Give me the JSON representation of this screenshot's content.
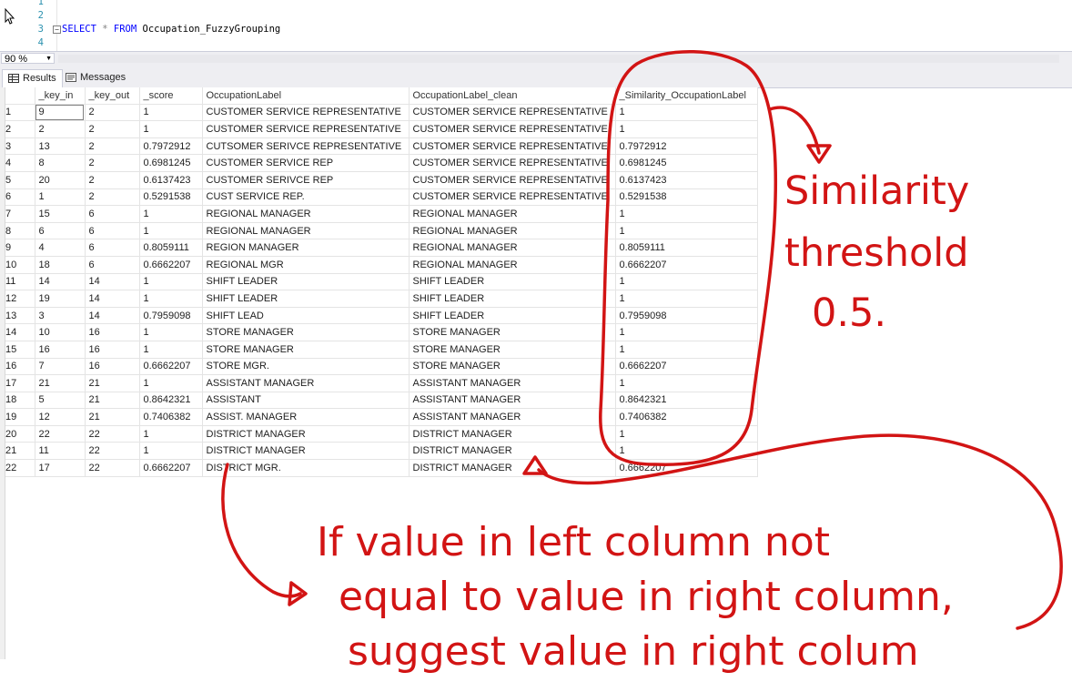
{
  "editor": {
    "lines": [
      {
        "num": "1",
        "code": ""
      },
      {
        "num": "2",
        "code": ""
      },
      {
        "num": "3",
        "kw1": "SELECT",
        "op": " * ",
        "kw2": "FROM",
        "rest": " Occupation_FuzzyGrouping"
      },
      {
        "num": "4",
        "code": ""
      }
    ],
    "collapse_glyph": "−"
  },
  "zoom": {
    "value": "90 %"
  },
  "tabs": {
    "results": "Results",
    "messages": "Messages"
  },
  "grid": {
    "columns": [
      "_key_in",
      "_key_out",
      "_score",
      "OccupationLabel",
      "OccupationLabel_clean",
      "_Similarity_OccupationLabel"
    ],
    "rows": [
      {
        "n": "1",
        "key_in": "9",
        "key_out": "2",
        "score": "1",
        "label": "CUSTOMER SERVICE REPRESENTATIVE",
        "clean": "CUSTOMER SERVICE REPRESENTATIVE",
        "sim": "1"
      },
      {
        "n": "2",
        "key_in": "2",
        "key_out": "2",
        "score": "1",
        "label": "CUSTOMER SERVICE REPRESENTATIVE",
        "clean": "CUSTOMER SERVICE REPRESENTATIVE",
        "sim": "1"
      },
      {
        "n": "3",
        "key_in": "13",
        "key_out": "2",
        "score": "0.7972912",
        "label": "CUTSOMER SERIVCE REPRESENTATIVE",
        "clean": "CUSTOMER SERVICE REPRESENTATIVE",
        "sim": "0.7972912"
      },
      {
        "n": "4",
        "key_in": "8",
        "key_out": "2",
        "score": "0.6981245",
        "label": "CUSTOMER SERVICE REP",
        "clean": "CUSTOMER SERVICE REPRESENTATIVE",
        "sim": "0.6981245"
      },
      {
        "n": "5",
        "key_in": "20",
        "key_out": "2",
        "score": "0.6137423",
        "label": "CUSTOMER SERIVCE REP",
        "clean": "CUSTOMER SERVICE REPRESENTATIVE",
        "sim": "0.6137423"
      },
      {
        "n": "6",
        "key_in": "1",
        "key_out": "2",
        "score": "0.5291538",
        "label": "CUST SERVICE REP.",
        "clean": "CUSTOMER SERVICE REPRESENTATIVE",
        "sim": "0.5291538"
      },
      {
        "n": "7",
        "key_in": "15",
        "key_out": "6",
        "score": "1",
        "label": "REGIONAL MANAGER",
        "clean": "REGIONAL MANAGER",
        "sim": "1"
      },
      {
        "n": "8",
        "key_in": "6",
        "key_out": "6",
        "score": "1",
        "label": "REGIONAL MANAGER",
        "clean": "REGIONAL MANAGER",
        "sim": "1"
      },
      {
        "n": "9",
        "key_in": "4",
        "key_out": "6",
        "score": "0.8059111",
        "label": "REGION MANAGER",
        "clean": "REGIONAL MANAGER",
        "sim": "0.8059111"
      },
      {
        "n": "10",
        "key_in": "18",
        "key_out": "6",
        "score": "0.6662207",
        "label": "REGIONAL MGR",
        "clean": "REGIONAL MANAGER",
        "sim": "0.6662207"
      },
      {
        "n": "11",
        "key_in": "14",
        "key_out": "14",
        "score": "1",
        "label": "SHIFT LEADER",
        "clean": "SHIFT LEADER",
        "sim": "1"
      },
      {
        "n": "12",
        "key_in": "19",
        "key_out": "14",
        "score": "1",
        "label": "SHIFT LEADER",
        "clean": "SHIFT LEADER",
        "sim": "1"
      },
      {
        "n": "13",
        "key_in": "3",
        "key_out": "14",
        "score": "0.7959098",
        "label": "SHIFT LEAD",
        "clean": "SHIFT LEADER",
        "sim": "0.7959098"
      },
      {
        "n": "14",
        "key_in": "10",
        "key_out": "16",
        "score": "1",
        "label": "STORE MANAGER",
        "clean": "STORE MANAGER",
        "sim": "1"
      },
      {
        "n": "15",
        "key_in": "16",
        "key_out": "16",
        "score": "1",
        "label": "STORE MANAGER",
        "clean": "STORE MANAGER",
        "sim": "1"
      },
      {
        "n": "16",
        "key_in": "7",
        "key_out": "16",
        "score": "0.6662207",
        "label": "STORE MGR.",
        "clean": "STORE MANAGER",
        "sim": "0.6662207"
      },
      {
        "n": "17",
        "key_in": "21",
        "key_out": "21",
        "score": "1",
        "label": "ASSISTANT MANAGER",
        "clean": "ASSISTANT MANAGER",
        "sim": "1"
      },
      {
        "n": "18",
        "key_in": "5",
        "key_out": "21",
        "score": "0.8642321",
        "label": "ASSISTANT",
        "clean": "ASSISTANT MANAGER",
        "sim": "0.8642321"
      },
      {
        "n": "19",
        "key_in": "12",
        "key_out": "21",
        "score": "0.7406382",
        "label": "ASSIST. MANAGER",
        "clean": "ASSISTANT MANAGER",
        "sim": "0.7406382"
      },
      {
        "n": "20",
        "key_in": "22",
        "key_out": "22",
        "score": "1",
        "label": "DISTRICT MANAGER",
        "clean": "DISTRICT MANAGER",
        "sim": "1"
      },
      {
        "n": "21",
        "key_in": "11",
        "key_out": "22",
        "score": "1",
        "label": "DISTRICT MANAGER",
        "clean": "DISTRICT MANAGER",
        "sim": "1"
      },
      {
        "n": "22",
        "key_in": "17",
        "key_out": "22",
        "score": "0.6662207",
        "label": "DISTRICT MGR.",
        "clean": "DISTRICT MANAGER",
        "sim": "0.6662207"
      }
    ]
  },
  "annotations": {
    "threshold_line1": "Similarity",
    "threshold_line2": "threshold",
    "threshold_line3": "0.5.",
    "note_line1": "If value in left column not",
    "note_line2": "equal to value in right column,",
    "note_line3": "suggest value in right colum",
    "ink_color": "#d21414"
  }
}
